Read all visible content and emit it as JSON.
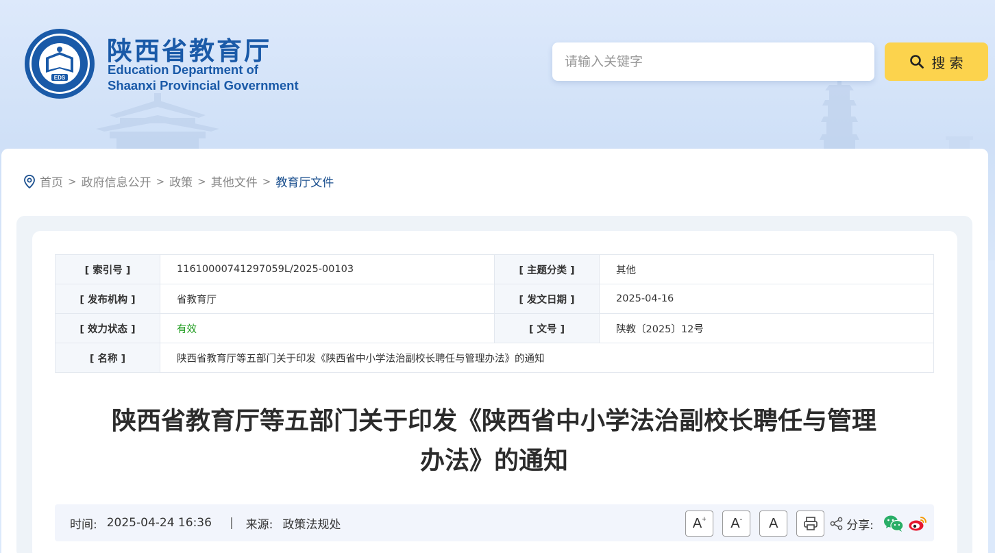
{
  "header": {
    "logo_cn": "陕西省教育厅",
    "logo_en_line1": "Education Department of",
    "logo_en_line2": "Shaanxi Provincial Government",
    "emblem_text": "EDS"
  },
  "search": {
    "placeholder": "请输入关键字",
    "button_label": "搜 索"
  },
  "breadcrumb": [
    {
      "label": "首页"
    },
    {
      "label": "政府信息公开"
    },
    {
      "label": "政策"
    },
    {
      "label": "其他文件"
    },
    {
      "label": "教育厅文件"
    }
  ],
  "breadcrumb_separator": ">",
  "meta": {
    "index_label": "[ 索引号 ]",
    "index_value": "11610000741297059L/2025-00103",
    "topic_label": "[ 主题分类 ]",
    "topic_value": "其他",
    "org_label": "[ 发布机构 ]",
    "org_value": "省教育厅",
    "date_label": "[ 发文日期 ]",
    "date_value": "2025-04-16",
    "status_label": "[ 效力状态 ]",
    "status_value": "有效",
    "docno_label": "[ 文号 ]",
    "docno_value": "陕教〔2025〕12号",
    "name_label": "[ 名称 ]",
    "name_value": "陕西省教育厅等五部门关于印发《陕西省中小学法治副校长聘任与管理办法》的通知"
  },
  "document": {
    "title_line1": "陕西省教育厅等五部门关于印发《陕西省中小学法治副校长聘任与管理",
    "title_line2": "办法》的通知"
  },
  "info_bar": {
    "time_label": "时间:",
    "time_value": "2025-04-24 16:36",
    "divider": "|",
    "source_label": "来源:",
    "source_value": "政策法规处",
    "font_large": "A",
    "font_large_sup": "+",
    "font_small": "A",
    "font_small_sup": "-",
    "font_default": "A",
    "share_label": "分享:"
  },
  "colors": {
    "brand_blue": "#1a5aa8",
    "search_button": "#fcd34d",
    "status_valid": "#1a9a1a",
    "breadcrumb_current": "#1a4f8e"
  }
}
